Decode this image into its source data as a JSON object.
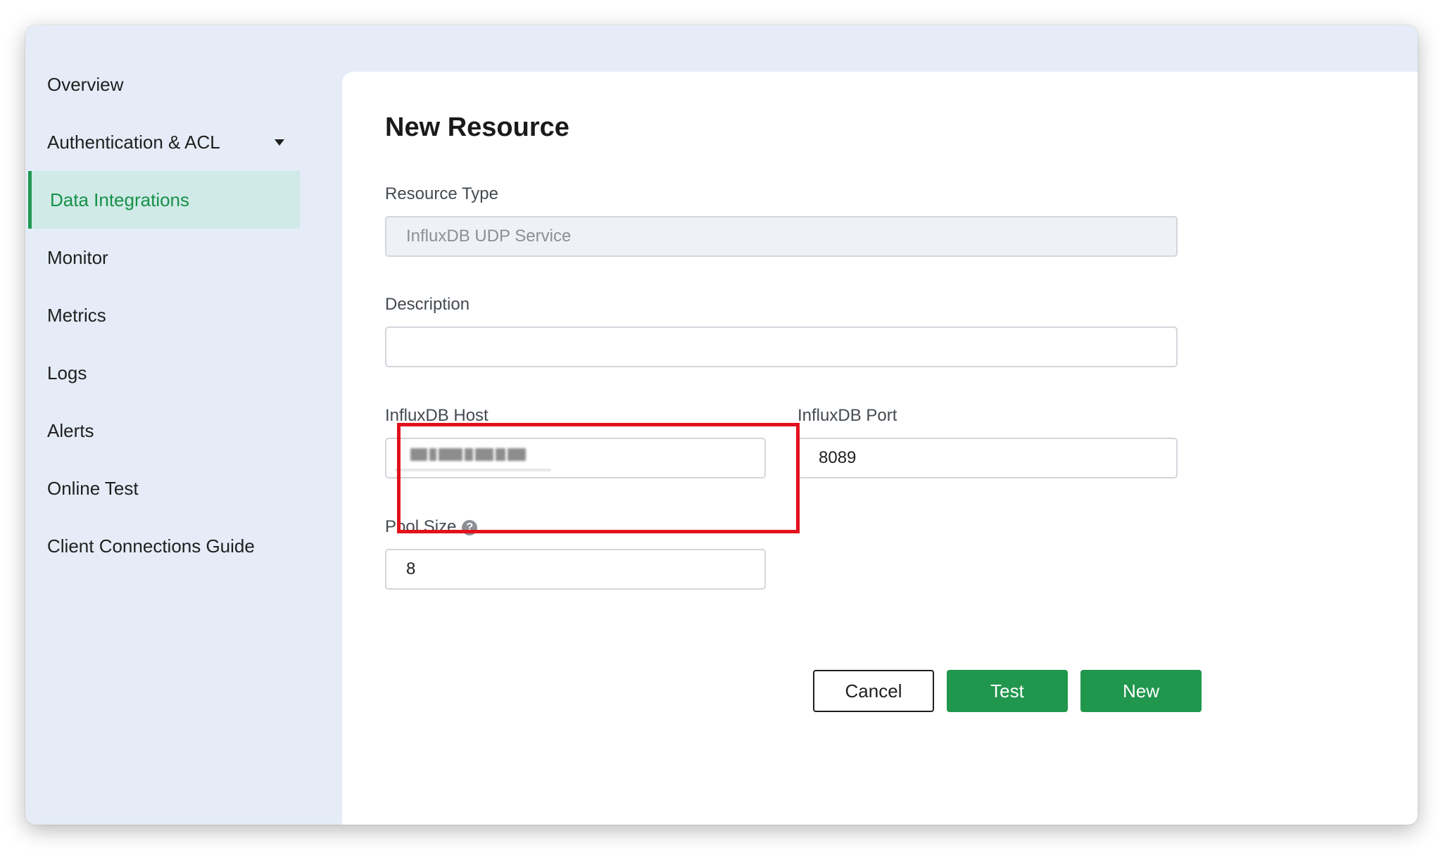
{
  "sidebar": {
    "items": [
      {
        "label": "Overview"
      },
      {
        "label": "Authentication & ACL"
      },
      {
        "label": "Data Integrations"
      },
      {
        "label": "Monitor"
      },
      {
        "label": "Metrics"
      },
      {
        "label": "Logs"
      },
      {
        "label": "Alerts"
      },
      {
        "label": "Online Test"
      },
      {
        "label": "Client Connections Guide"
      }
    ],
    "active": "Data Integrations"
  },
  "form": {
    "title": "New Resource",
    "resource_type": {
      "label": "Resource Type",
      "value": "InfluxDB UDP Service"
    },
    "description": {
      "label": "Description",
      "value": ""
    },
    "host": {
      "label": "InfluxDB Host",
      "value": "(redacted)"
    },
    "port": {
      "label": "InfluxDB Port",
      "value": "8089"
    },
    "pool_size": {
      "label": "Pool Size",
      "value": "8",
      "help_icon": "question-circle-icon"
    },
    "buttons": {
      "cancel": "Cancel",
      "test": "Test",
      "new": "New"
    }
  },
  "colors": {
    "accent": "#21964d",
    "active_nav_bg": "#d0eae8",
    "highlight": "#e2111c",
    "sidebar_bg": "#e5ecf7"
  }
}
